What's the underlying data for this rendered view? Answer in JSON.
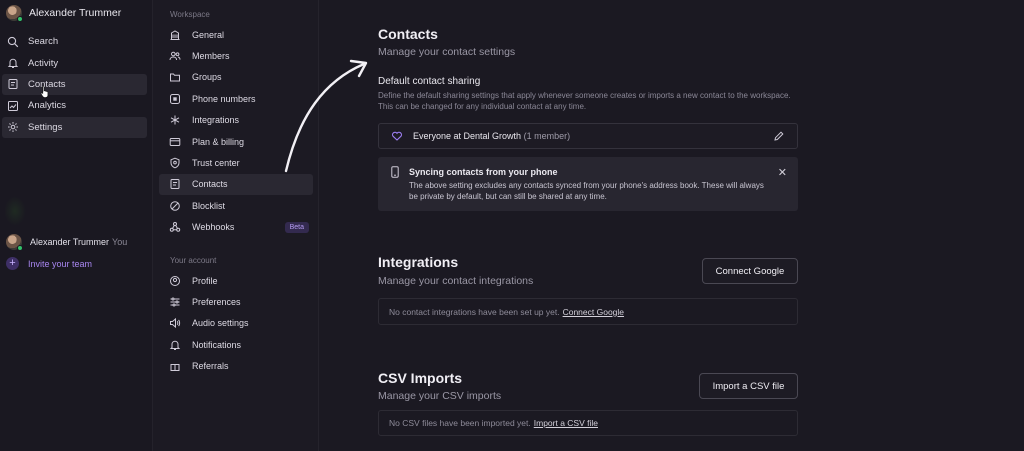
{
  "left_nav": {
    "user_name": "Alexander Trummer",
    "items": [
      {
        "label": "Search",
        "icon": "search-icon"
      },
      {
        "label": "Activity",
        "icon": "bell-icon"
      },
      {
        "label": "Contacts",
        "icon": "contacts-icon"
      },
      {
        "label": "Analytics",
        "icon": "analytics-icon"
      },
      {
        "label": "Settings",
        "icon": "gear-icon"
      }
    ],
    "member_name": "Alexander Trummer",
    "member_you": "You",
    "invite_label": "Invite your team"
  },
  "settings_nav": {
    "workspace_label": "Workspace",
    "workspace_items": [
      {
        "label": "General",
        "icon": "building-icon"
      },
      {
        "label": "Members",
        "icon": "users-icon"
      },
      {
        "label": "Groups",
        "icon": "folder-icon"
      },
      {
        "label": "Phone numbers",
        "icon": "hash-icon"
      },
      {
        "label": "Integrations",
        "icon": "asterisk-icon"
      },
      {
        "label": "Plan & billing",
        "icon": "card-icon"
      },
      {
        "label": "Trust center",
        "icon": "shield-icon"
      },
      {
        "label": "Contacts",
        "icon": "contacts-icon"
      },
      {
        "label": "Blocklist",
        "icon": "block-icon"
      },
      {
        "label": "Webhooks",
        "icon": "webhook-icon",
        "badge": "Beta"
      }
    ],
    "account_label": "Your account",
    "account_items": [
      {
        "label": "Profile",
        "icon": "profile-icon"
      },
      {
        "label": "Preferences",
        "icon": "sliders-icon"
      },
      {
        "label": "Audio settings",
        "icon": "speaker-icon"
      },
      {
        "label": "Notifications",
        "icon": "bell-icon"
      },
      {
        "label": "Referrals",
        "icon": "gift-icon"
      }
    ]
  },
  "contacts": {
    "title": "Contacts",
    "subtitle": "Manage your contact settings",
    "default_sharing_title": "Default contact sharing",
    "default_sharing_desc": "Define the default sharing settings that apply whenever someone creates or imports a new contact to the workspace. This can be changed for any individual contact at any time.",
    "sharing_value": "Everyone at Dental Growth",
    "sharing_count": "(1 member)",
    "notice_title": "Syncing contacts from your phone",
    "notice_body": "The above setting excludes any contacts synced from your phone's address book. These will always be private by default, but can still be shared at any time."
  },
  "integrations": {
    "title": "Integrations",
    "subtitle": "Manage your contact integrations",
    "button": "Connect Google",
    "empty_text": "No contact integrations have been set up yet.",
    "empty_link": "Connect Google"
  },
  "csv": {
    "title": "CSV Imports",
    "subtitle": "Manage your CSV imports",
    "button": "Import a CSV file",
    "empty_text": "No CSV files have been imported yet.",
    "empty_link": "Import a CSV file"
  },
  "colors": {
    "background": "#1b1922",
    "accent": "#a886f0",
    "online": "#32c26b"
  }
}
